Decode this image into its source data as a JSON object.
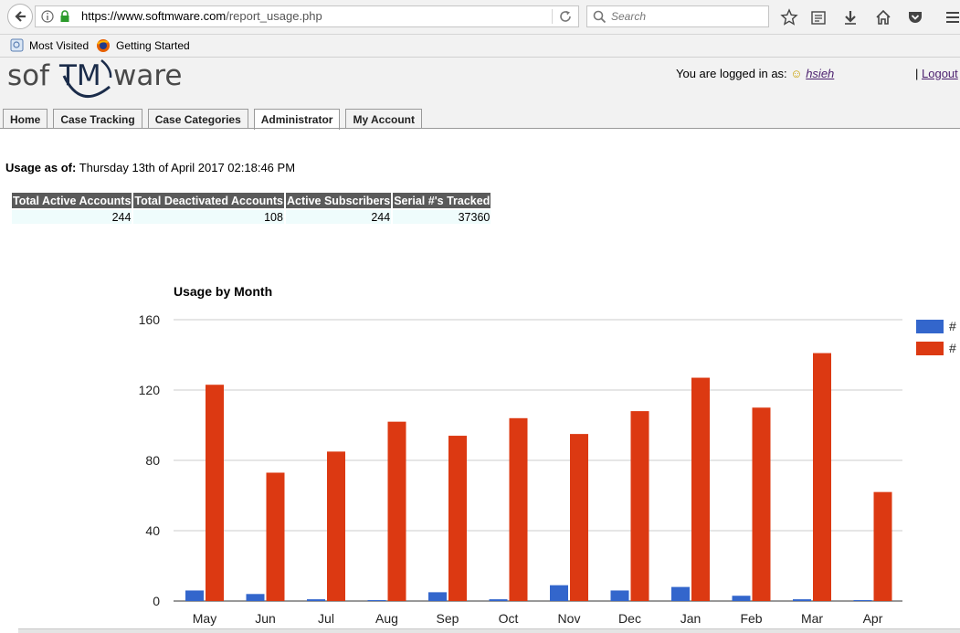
{
  "browser": {
    "url_host": "https://www.softmware.com",
    "url_path": "/report_usage.php",
    "search_placeholder": "Search",
    "bookmarks": [
      {
        "label": "Most Visited"
      },
      {
        "label": "Getting Started"
      }
    ]
  },
  "site": {
    "logo": "sofTMware",
    "logged_in_prefix": "You are logged in as:",
    "username": "hsieh",
    "logout_label": "Logout",
    "logout_pipe": "|",
    "nav": [
      "Home",
      "Case Tracking",
      "Case Categories",
      "Administrator",
      "My Account"
    ],
    "active_tab": "Administrator"
  },
  "report": {
    "usage_label": "Usage as of:",
    "usage_date": "Thursday 13th of April 2017 02:18:46 PM",
    "stats_headers": [
      "Total Active Accounts",
      "Total Deactivated Accounts",
      "Active Subscribers",
      "Serial #'s Tracked"
    ],
    "stats_values": [
      "244",
      "108",
      "244",
      "37360"
    ]
  },
  "chart_data": {
    "type": "bar",
    "title": "Usage by Month",
    "xlabel": "",
    "ylabel": "",
    "categories": [
      "May",
      "Jun",
      "Jul",
      "Aug",
      "Sep",
      "Oct",
      "Nov",
      "Dec",
      "Jan",
      "Feb",
      "Mar",
      "Apr"
    ],
    "series": [
      {
        "name": "#",
        "color": "#3366cc",
        "values": [
          6,
          4,
          1,
          0,
          5,
          1,
          9,
          6,
          8,
          3,
          1,
          0
        ]
      },
      {
        "name": "#",
        "color": "#dc3912",
        "values": [
          123,
          73,
          85,
          102,
          94,
          104,
          95,
          108,
          127,
          110,
          141,
          62
        ]
      }
    ],
    "yticks": [
      0,
      40,
      80,
      120,
      160
    ],
    "ylim": [
      0,
      160
    ],
    "grid": true,
    "legend_position": "right"
  }
}
